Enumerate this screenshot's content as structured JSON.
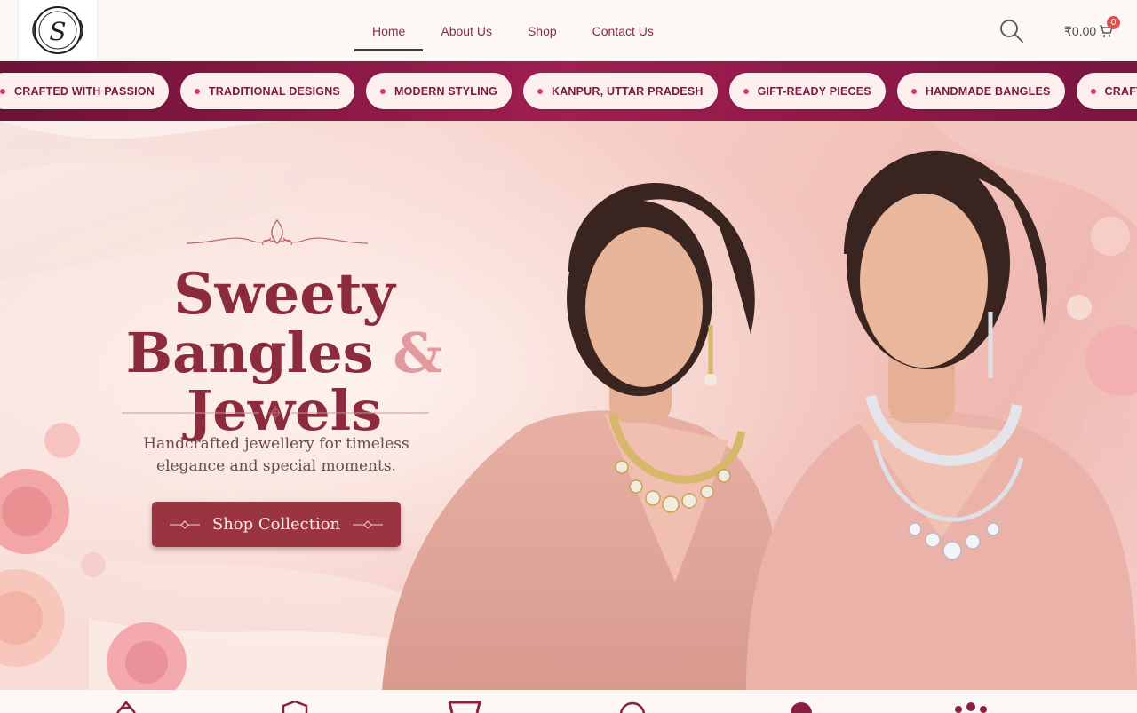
{
  "header": {
    "logo_alt": "Sweety Bangles & Jewels logo",
    "nav": [
      {
        "label": "Home",
        "active": true
      },
      {
        "label": "About Us",
        "active": false
      },
      {
        "label": "Shop",
        "active": false
      },
      {
        "label": "Contact Us",
        "active": false
      }
    ],
    "search_icon": "search-icon",
    "cart": {
      "total": "₹0.00",
      "count": "0",
      "icon": "cart-icon"
    }
  },
  "marquee": {
    "items": [
      "CRAFTED WITH PASSION",
      "TRADITIONAL DESIGNS",
      "MODERN STYLING",
      "KANPUR, UTTAR PRADESH",
      "GIFT-READY PIECES",
      "HANDMADE BANGLES",
      "CRAFTED WITH PA"
    ]
  },
  "hero": {
    "title_line1": "Sweety",
    "title_line2_a": "Bangles",
    "title_amp": "&",
    "title_line2_b": "Jewels",
    "subtitle_line1": "Handcrafted jewellery for timeless",
    "subtitle_line2": "elegance and special moments.",
    "cta_label": "Shop Collection"
  },
  "colors": {
    "brand": "#8b2a48",
    "marquee_bg": "#a01e51",
    "cta_bg": "#9a3440"
  }
}
